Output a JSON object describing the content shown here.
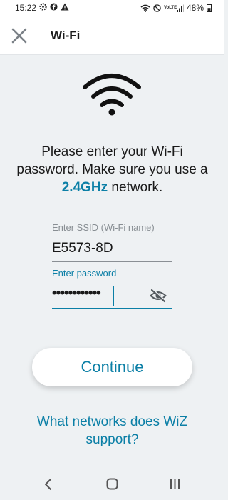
{
  "status_bar": {
    "time": "15:22",
    "left_icons": [
      "settings-gear-icon",
      "facebook-icon",
      "warning-icon"
    ],
    "right_icons": [
      "wifi-icon",
      "do-not-disturb-icon",
      "volte-icon",
      "signal-icon"
    ],
    "volte_text": "VoLTE",
    "battery": "48%"
  },
  "header": {
    "title": "Wi-Fi",
    "close_icon": "close-icon"
  },
  "main": {
    "wifi_icon": "wifi-icon",
    "message_part1": "Please enter your Wi-Fi password. Make sure you use a ",
    "message_accent": "2.4GHz",
    "message_part2": " network.",
    "ssid_label": "Enter SSID (Wi-Fi name)",
    "ssid_value": "E5573-8D",
    "password_label": "Enter password",
    "password_value": "••••••••••••",
    "visibility_icon": "eye-off-icon",
    "continue_label": "Continue",
    "networks_link": "What networks does WiZ support?"
  },
  "nav": {
    "back_icon": "back-icon",
    "home_icon": "home-icon",
    "recents_icon": "recents-icon"
  },
  "colors": {
    "accent": "#0b7fa6",
    "background": "#eef1f3",
    "header_bg": "#ffffff"
  }
}
